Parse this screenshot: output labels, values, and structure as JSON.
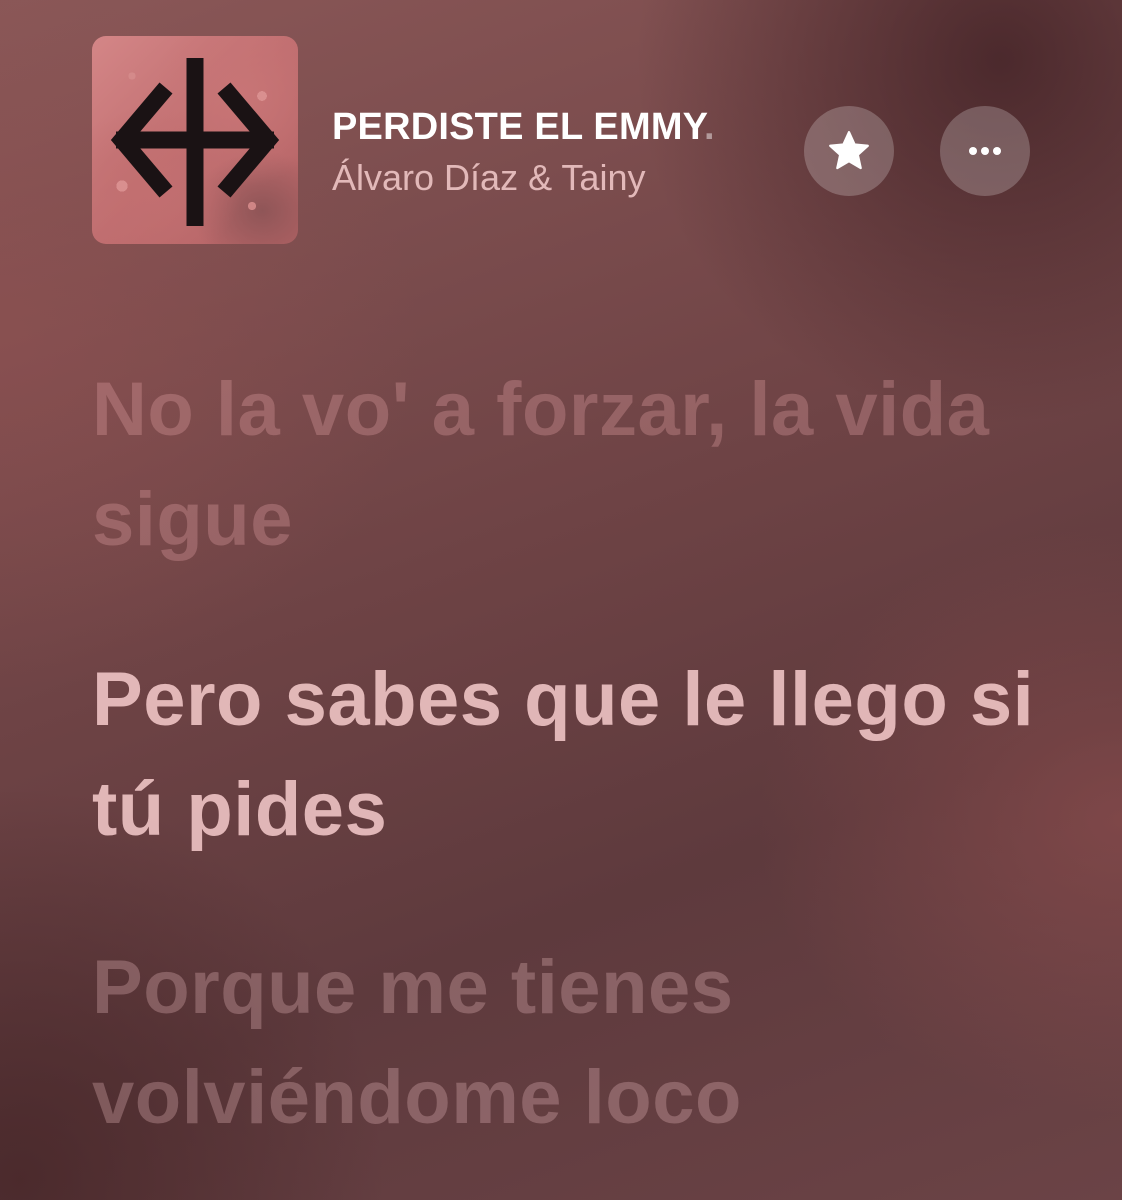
{
  "now_playing": {
    "title_main": "PERDISTE EL EMMY",
    "title_fade": ".",
    "artist": "Álvaro Díaz & Tainy",
    "album_art_label": "album-cover"
  },
  "controls": {
    "favorite_icon": "star-icon",
    "more_icon": "ellipsis-icon"
  },
  "lyrics": [
    {
      "text": "No la vo' a forzar, la vida sigue",
      "state": "past"
    },
    {
      "text": "Pero sabes que le llego si tú pides",
      "state": "current"
    },
    {
      "text": "Porque me tienes volviéndome loco",
      "state": "upcoming"
    }
  ],
  "colors": {
    "background": "#6e4345",
    "active_lyric": "#ffd4d4",
    "button_bg": "rgba(255,255,255,0.22)"
  }
}
